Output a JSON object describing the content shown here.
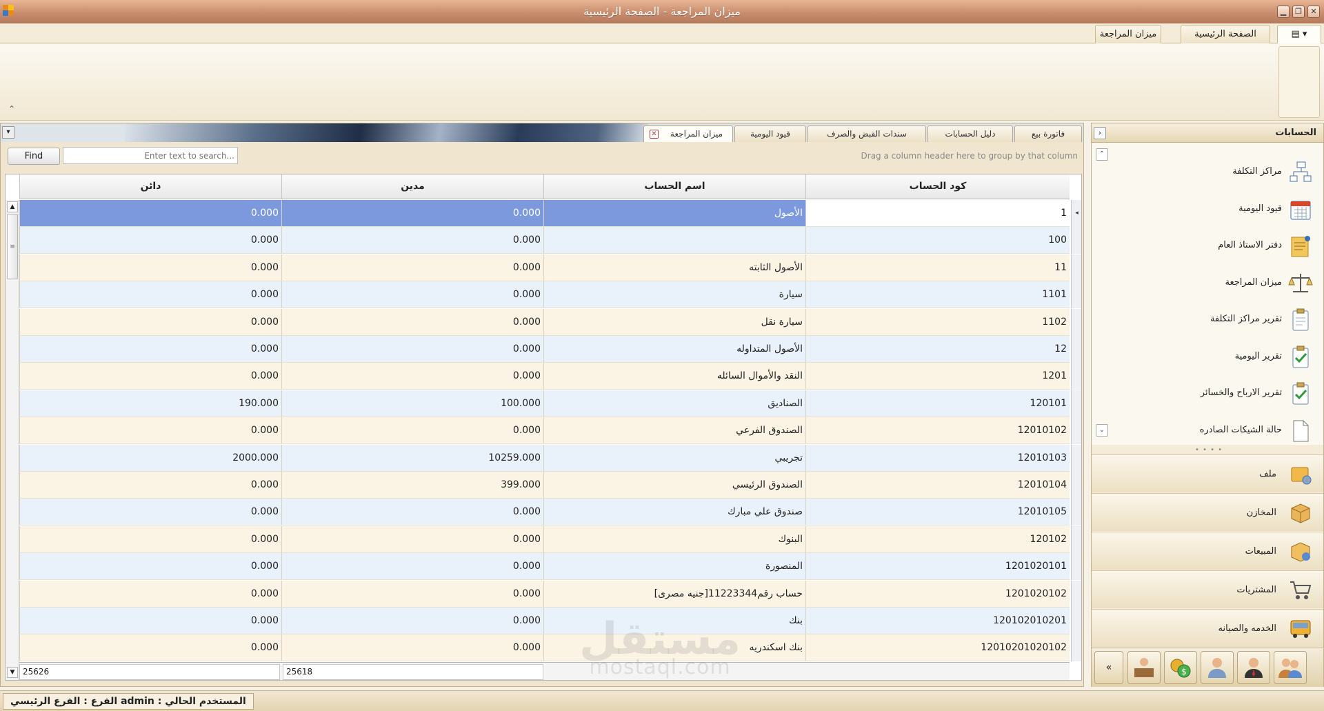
{
  "window": {
    "title": "ميزان المراجعة - الصفحة الرئيسية"
  },
  "ribbon": {
    "tabs": [
      {
        "label": "ميزان المراجعة"
      },
      {
        "label": "الصفحة الرئيسية"
      }
    ]
  },
  "document_tabs": [
    {
      "label": "ميزان المراجعة"
    },
    {
      "label": "قيود اليومية"
    },
    {
      "label": "سندات القبض والصرف"
    },
    {
      "label": "دليل الحسابات"
    },
    {
      "label": "فاتورة بيع"
    }
  ],
  "findbar": {
    "find_label": "Find",
    "search_placeholder": "Enter text to search...",
    "group_hint": "Drag a column header here to group by that column"
  },
  "grid": {
    "columns": {
      "code": "كود الحساب",
      "name": "اسم الحساب",
      "debit": "مدين",
      "credit": "دائن"
    },
    "rows": [
      {
        "code": "1",
        "name": "الأصول",
        "debit": "0.000",
        "credit": "0.000"
      },
      {
        "code": "100",
        "name": "",
        "debit": "0.000",
        "credit": "0.000"
      },
      {
        "code": "11",
        "name": "الأصول الثابته",
        "debit": "0.000",
        "credit": "0.000"
      },
      {
        "code": "1101",
        "name": "سيارة",
        "debit": "0.000",
        "credit": "0.000"
      },
      {
        "code": "1102",
        "name": "سيارة نقل",
        "debit": "0.000",
        "credit": "0.000"
      },
      {
        "code": "12",
        "name": "الأصول المتداوله",
        "debit": "0.000",
        "credit": "0.000"
      },
      {
        "code": "1201",
        "name": "النقد والأموال السائله",
        "debit": "0.000",
        "credit": "0.000"
      },
      {
        "code": "120101",
        "name": "الصناديق",
        "debit": "100.000",
        "credit": "190.000"
      },
      {
        "code": "12010102",
        "name": "الصندوق الفرعي",
        "debit": "0.000",
        "credit": "0.000"
      },
      {
        "code": "12010103",
        "name": "تجريبي",
        "debit": "10259.000",
        "credit": "2000.000"
      },
      {
        "code": "12010104",
        "name": "الصندوق الرئيسي",
        "debit": "399.000",
        "credit": "0.000"
      },
      {
        "code": "12010105",
        "name": "صندوق علي مبارك",
        "debit": "0.000",
        "credit": "0.000"
      },
      {
        "code": "120102",
        "name": "البنوك",
        "debit": "0.000",
        "credit": "0.000"
      },
      {
        "code": "1201020101",
        "name": "المنصورة",
        "debit": "0.000",
        "credit": "0.000"
      },
      {
        "code": "1201020102",
        "name": "حساب رقم11223344[جنيه مصرى]",
        "debit": "0.000",
        "credit": "0.000"
      },
      {
        "code": "120102010201",
        "name": "بنك",
        "debit": "0.000",
        "credit": "0.000"
      },
      {
        "code": "12010201020102",
        "name": "بنك اسكندريه",
        "debit": "0.000",
        "credit": "0.000"
      }
    ],
    "footer": {
      "credit_total": "25626",
      "debit_total": "25618"
    }
  },
  "navpanel": {
    "title": "الحسابات",
    "items": [
      {
        "label": "مراكز التكلفة",
        "icon": "cost-centers-icon"
      },
      {
        "label": "قيود اليومية",
        "icon": "calendar-icon"
      },
      {
        "label": "دفتر الاستاذ العام",
        "icon": "ledger-icon"
      },
      {
        "label": "ميزان المراجعة",
        "icon": "balance-scale-icon"
      },
      {
        "label": "تقرير مراكز التكلفة",
        "icon": "clipboard-icon"
      },
      {
        "label": "تقرير اليومية",
        "icon": "clipboard-check-icon"
      },
      {
        "label": "تقرير الارباح والخسائر",
        "icon": "clipboard-check-icon"
      },
      {
        "label": "حالة الشيكات الصادره",
        "icon": "document-icon"
      }
    ],
    "groups": [
      {
        "label": "ملف",
        "icon": "file-settings-icon"
      },
      {
        "label": "المخازن",
        "icon": "box-icon"
      },
      {
        "label": "المبيعات",
        "icon": "sales-box-icon"
      },
      {
        "label": "المشتريات",
        "icon": "cart-icon"
      },
      {
        "label": "الخدمه والصيانه",
        "icon": "bus-icon"
      }
    ],
    "bottom_icons": [
      "cashier-icon",
      "money-icon",
      "user-icon",
      "manager-icon",
      "users-icon"
    ]
  },
  "statusbar": {
    "text": "المستخدم الحالي : admin   الفرع  :  الفرع الرئيسي"
  },
  "watermark": {
    "arabic": "مستقل",
    "latin": "mostaql.com"
  },
  "colors": {
    "selected_row": "#7b99dc",
    "odd_row": "#fbf3e4",
    "even_row": "#e9f1fb",
    "titlebar": "#c88d6d"
  }
}
